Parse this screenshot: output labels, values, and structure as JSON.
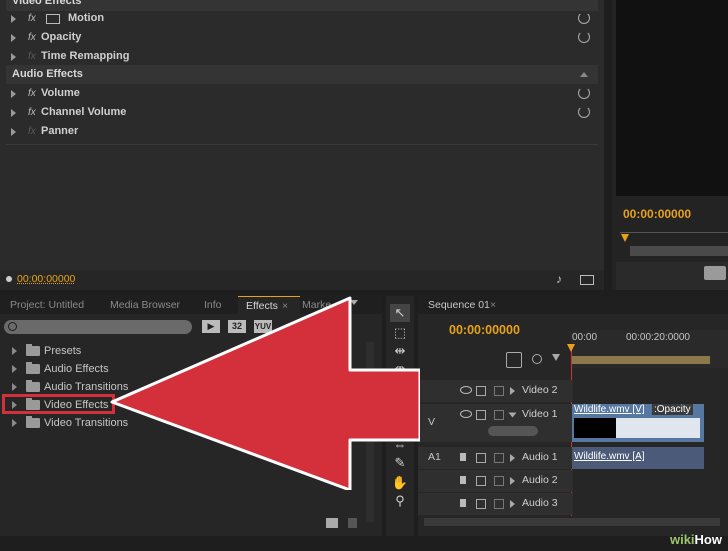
{
  "effect_controls": {
    "video_effects_header": "Video Effects",
    "video_items": [
      {
        "fx": "fx",
        "label": "Motion"
      },
      {
        "fx": "fx",
        "label": "Opacity"
      },
      {
        "fx": "fx",
        "label": "Time Remapping"
      }
    ],
    "audio_effects_header": "Audio Effects",
    "audio_items": [
      {
        "fx": "fx",
        "label": "Volume"
      },
      {
        "fx": "fx",
        "label": "Channel Volume"
      },
      {
        "fx": "fx",
        "label": "Panner"
      }
    ],
    "timecode": "00:00:00000"
  },
  "program_monitor": {
    "timecode": "00:00:00000"
  },
  "effects_panel": {
    "tabs": [
      "Project: Untitled",
      "Media Browser",
      "Info",
      "Effects",
      "Marke"
    ],
    "active_tab": "Effects",
    "filter_buttons": [
      "32",
      "YUV"
    ],
    "tree": [
      "Presets",
      "Audio Effects",
      "Audio Transitions",
      "Video Effects",
      "Video Transitions"
    ],
    "highlighted": "Video Effects"
  },
  "timeline": {
    "tab": "Sequence 01",
    "timecode": "00:00:00000",
    "ruler": [
      "00:00",
      "00:00:20:0000"
    ],
    "tracks": {
      "video2": "Video 2",
      "video1": "Video 1",
      "audio1": "Audio 1",
      "audio2": "Audio 2",
      "audio3": "Audio 3"
    },
    "track_targets": {
      "v": "V",
      "a1": "A1"
    },
    "clips": {
      "video": "Wildlife.wmv [V]",
      "video_effect": ":Opacity",
      "audio": "Wildlife.wmv [A]"
    }
  },
  "watermark": {
    "wiki": "wiki",
    "how": "How"
  },
  "colors": {
    "accent": "#e8a21a",
    "arrow": "#d4303b",
    "clip": "#5577a0"
  }
}
